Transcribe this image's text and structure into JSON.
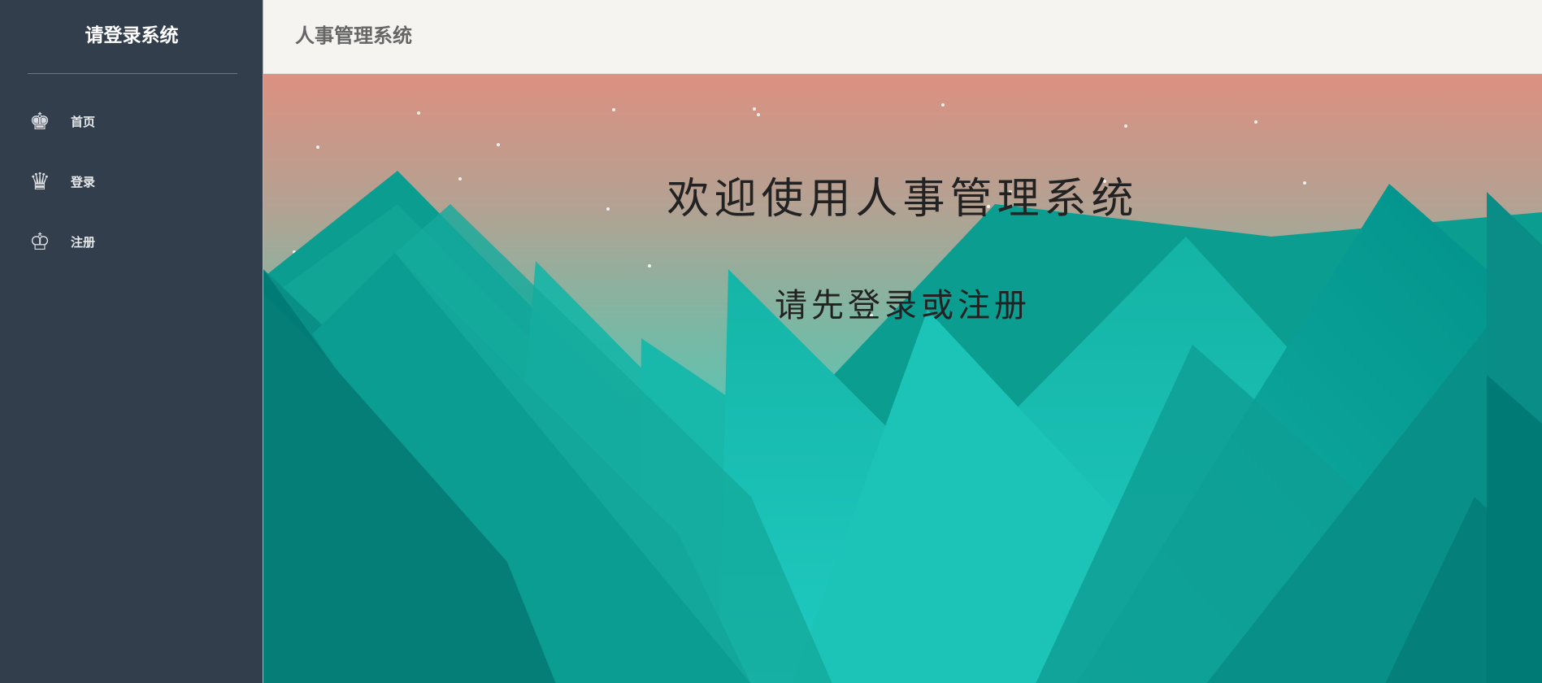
{
  "sidebar": {
    "title": "请登录系统",
    "items": [
      {
        "label": "首页",
        "icon": "king-icon",
        "glyph": "♚"
      },
      {
        "label": "登录",
        "icon": "queen-icon",
        "glyph": "♛"
      },
      {
        "label": "注册",
        "icon": "king-outline-icon",
        "glyph": "♔"
      }
    ]
  },
  "header": {
    "title": "人事管理系统"
  },
  "hero": {
    "heading": "欢迎使用人事管理系统",
    "subheading": "请先登录或注册"
  },
  "colors": {
    "sidebar_bg": "#333e4d",
    "header_bg": "#f5f4f0",
    "sky_top": "#dc9080",
    "sky_bottom": "#4fc8b8",
    "mountain_teal": "#0f9e90",
    "mountain_dark": "#007b76"
  }
}
